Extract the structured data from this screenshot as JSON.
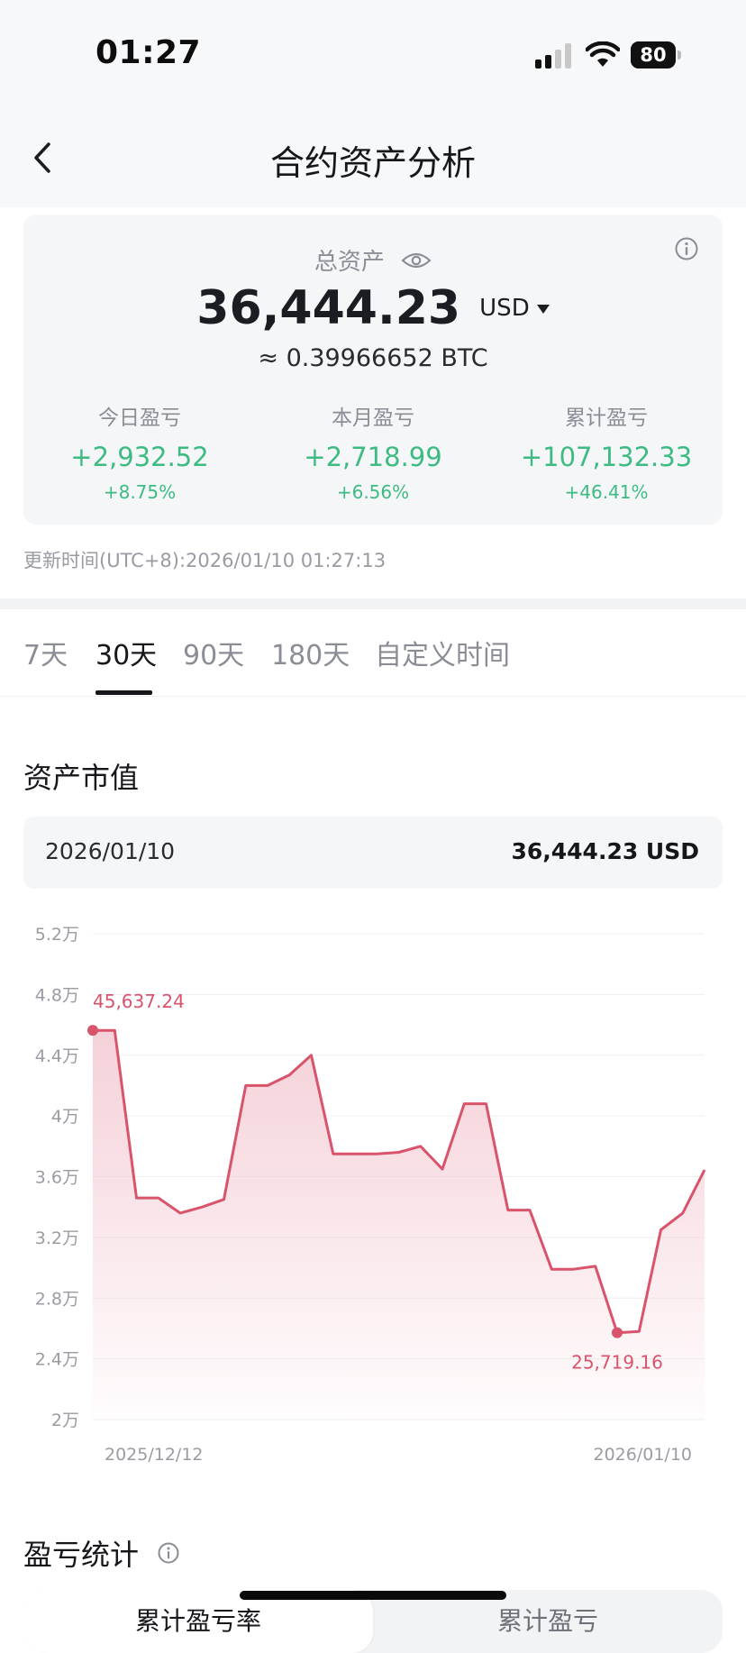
{
  "status_bar": {
    "time": "01:27",
    "battery": "80",
    "battery_level": 0.8
  },
  "header": {
    "title": "合约资产分析"
  },
  "summary": {
    "total_label": "总资产",
    "total_value": "36,444.23",
    "currency": "USD",
    "btc_equiv": "≈ 0.39966652 BTC",
    "stats": [
      {
        "label": "今日盈亏",
        "value": "+2,932.52",
        "pct": "+8.75%"
      },
      {
        "label": "本月盈亏",
        "value": "+2,718.99",
        "pct": "+6.56%"
      },
      {
        "label": "累计盈亏",
        "value": "+107,132.33",
        "pct": "+46.41%"
      }
    ],
    "update_time": "更新时间(UTC+8):2026/01/10 01:27:13"
  },
  "tabs": [
    "7天",
    "30天",
    "90天",
    "180天",
    "自定义时间"
  ],
  "active_tab": "30天",
  "asset_section": {
    "title": "资产市值",
    "selected_date": "2026/01/10",
    "selected_value": "36,444.23 USD"
  },
  "chart_data": {
    "type": "area",
    "y_ticks": [
      "5.2万",
      "4.8万",
      "4.4万",
      "4万",
      "3.6万",
      "3.2万",
      "2.8万",
      "2.4万",
      "2万"
    ],
    "ylim": [
      20000,
      52000
    ],
    "x_labels": [
      "2025/12/12",
      "2026/01/10"
    ],
    "max_label": "45,637.24",
    "min_label": "25,719.16",
    "line_color": "#d9536b",
    "fill_color": "#f3c9d2",
    "series": [
      {
        "date": "2025/12/12",
        "value": 45637
      },
      {
        "date": "2025/12/13",
        "value": 45637
      },
      {
        "date": "2025/12/14",
        "value": 34600
      },
      {
        "date": "2025/12/15",
        "value": 34600
      },
      {
        "date": "2025/12/16",
        "value": 33600
      },
      {
        "date": "2025/12/17",
        "value": 34000
      },
      {
        "date": "2025/12/18",
        "value": 34500
      },
      {
        "date": "2025/12/19",
        "value": 42000
      },
      {
        "date": "2025/12/20",
        "value": 42000
      },
      {
        "date": "2025/12/21",
        "value": 42700
      },
      {
        "date": "2025/12/22",
        "value": 44000
      },
      {
        "date": "2025/12/23",
        "value": 37500
      },
      {
        "date": "2025/12/24",
        "value": 37500
      },
      {
        "date": "2025/12/25",
        "value": 37500
      },
      {
        "date": "2025/12/26",
        "value": 37600
      },
      {
        "date": "2025/12/27",
        "value": 38000
      },
      {
        "date": "2025/12/28",
        "value": 36500
      },
      {
        "date": "2025/12/29",
        "value": 40800
      },
      {
        "date": "2025/12/30",
        "value": 40800
      },
      {
        "date": "2025/12/31",
        "value": 33800
      },
      {
        "date": "2026/01/01",
        "value": 33800
      },
      {
        "date": "2026/01/02",
        "value": 29900
      },
      {
        "date": "2026/01/03",
        "value": 29900
      },
      {
        "date": "2026/01/04",
        "value": 30100
      },
      {
        "date": "2026/01/05",
        "value": 25719
      },
      {
        "date": "2026/01/06",
        "value": 25800
      },
      {
        "date": "2026/01/07",
        "value": 32500
      },
      {
        "date": "2026/01/08",
        "value": 33600
      },
      {
        "date": "2026/01/09",
        "value": 36444
      }
    ],
    "max_index": 0,
    "min_index": 24
  },
  "pnl_section": {
    "title": "盈亏统计",
    "segments": [
      "累计盈亏率",
      "累计盈亏"
    ]
  }
}
